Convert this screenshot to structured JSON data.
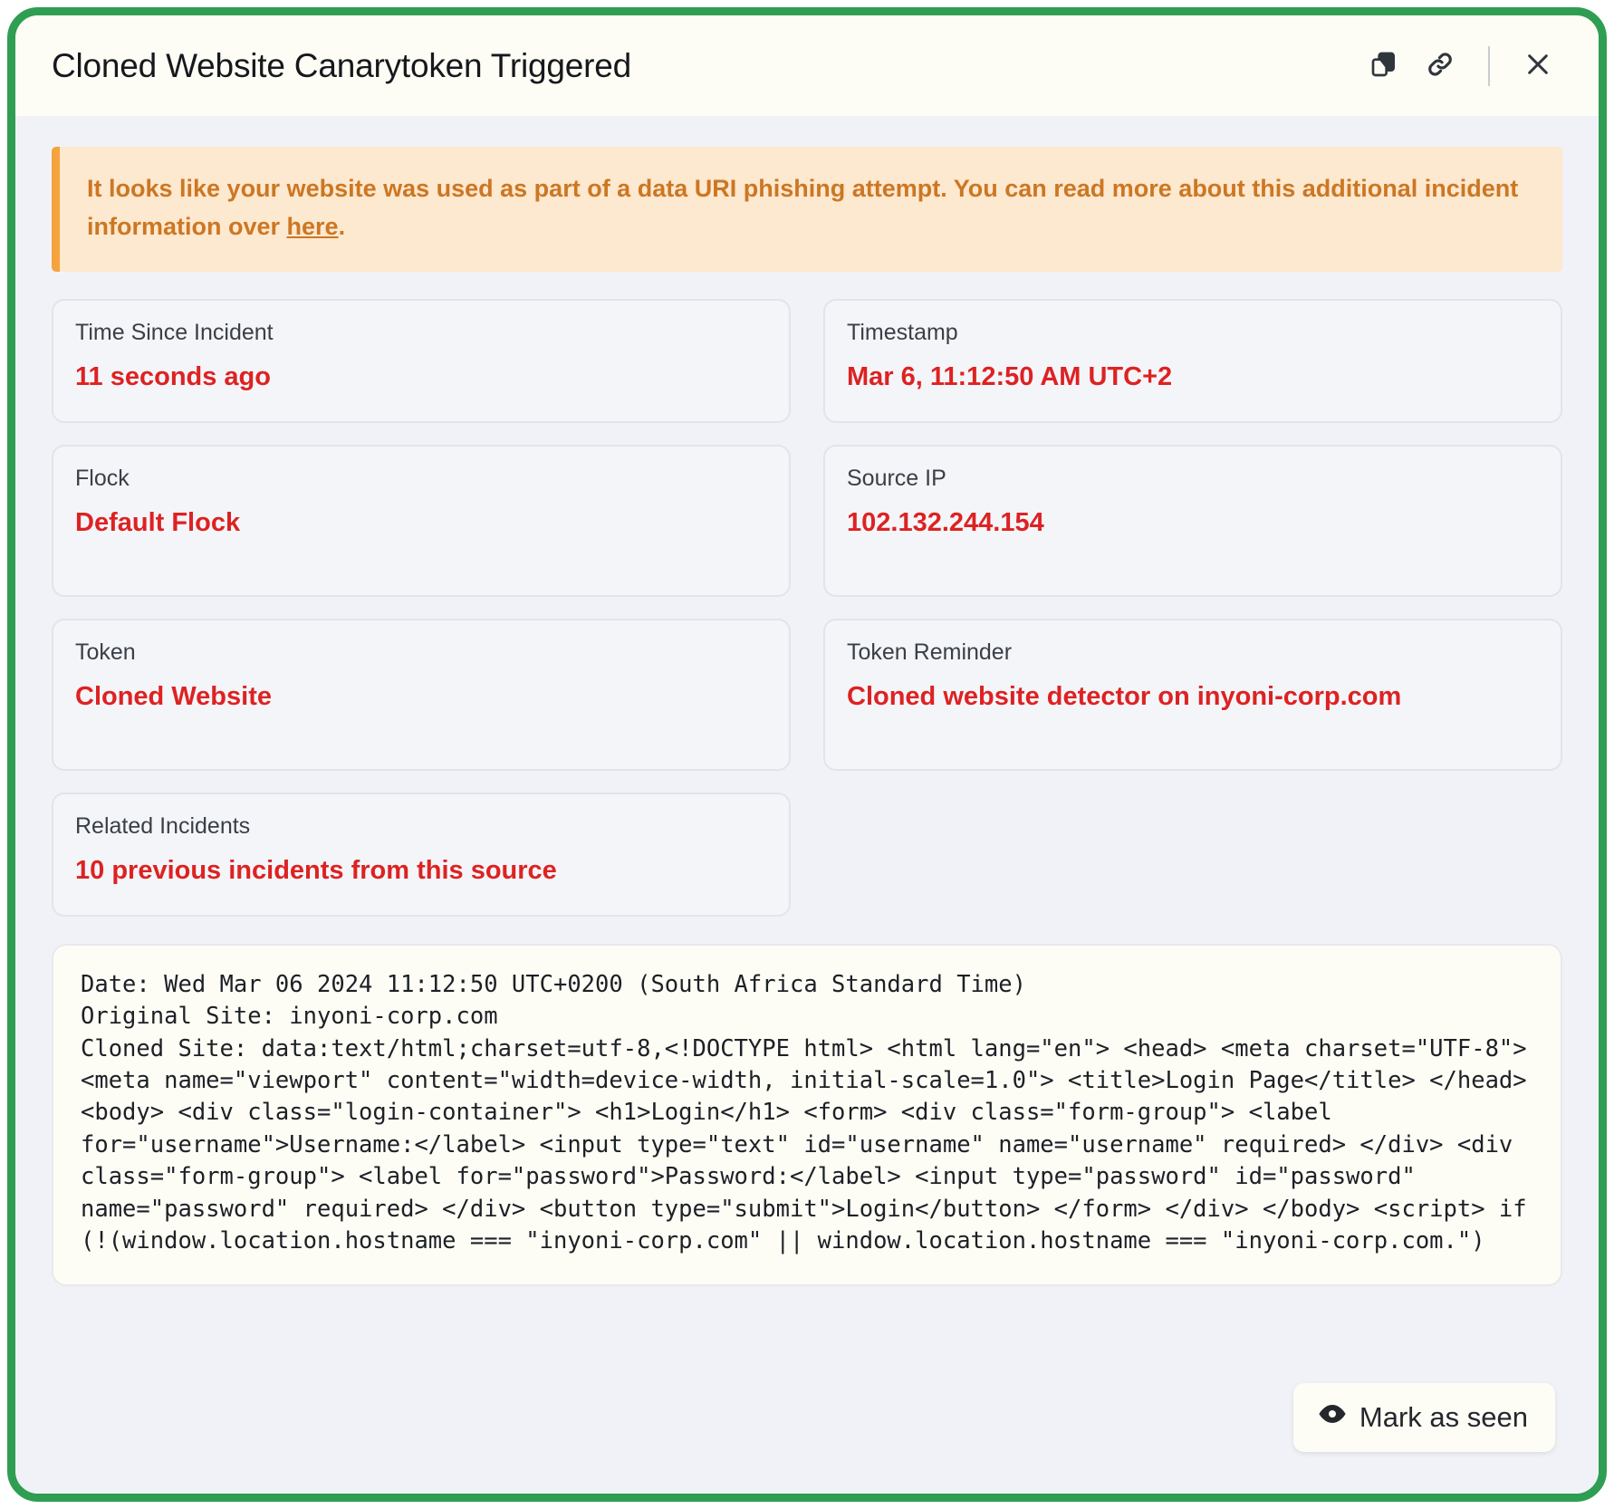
{
  "header": {
    "title": "Cloned Website Canarytoken Triggered",
    "actions": [
      {
        "name": "copy-icon",
        "label": "Copy"
      },
      {
        "name": "link-icon",
        "label": "Copy link"
      },
      {
        "name": "close-icon",
        "label": "Close"
      }
    ]
  },
  "alert": {
    "text_before": "It looks like your website was used as part of a data URI phishing attempt. You can read more about this additional incident information over ",
    "link_text": "here",
    "text_after": "."
  },
  "info_cards": [
    {
      "label": "Time Since Incident",
      "value": "11 seconds ago"
    },
    {
      "label": "Timestamp",
      "value": "Mar 6, 11:12:50 AM UTC+2"
    },
    {
      "label": "Flock",
      "value": "Default Flock"
    },
    {
      "label": "Source IP",
      "value": "102.132.244.154"
    },
    {
      "label": "Token",
      "value": "Cloned Website"
    },
    {
      "label": "Token Reminder",
      "value": "Cloned website detector on inyoni-corp.com"
    },
    {
      "label": "Related Incidents",
      "value": "10 previous incidents from this source"
    }
  ],
  "code_block": {
    "content": "Date: Wed Mar 06 2024 11:12:50 UTC+0200 (South Africa Standard Time)\nOriginal Site: inyoni-corp.com\nCloned Site: data:text/html;charset=utf-8,<!DOCTYPE html> <html lang=\"en\"> <head> <meta charset=\"UTF-8\"> <meta name=\"viewport\" content=\"width=device-width, initial-scale=1.0\"> <title>Login Page</title> </head> <body> <div class=\"login-container\"> <h1>Login</h1> <form> <div class=\"form-group\"> <label for=\"username\">Username:</label> <input type=\"text\" id=\"username\" name=\"username\" required> </div> <div class=\"form-group\"> <label for=\"password\">Password:</label> <input type=\"password\" id=\"password\" name=\"password\" required> </div> <button type=\"submit\">Login</button> </form> </div> </body> <script> if (!(window.location.hostname === \"inyoni-corp.com\" || window.location.hostname === \"inyoni-corp.com.\")"
  },
  "footer": {
    "mark_as_seen_label": "Mark as seen"
  },
  "colors": {
    "frame_border": "#2f9e52",
    "alert_background": "#fde8d0",
    "alert_accent": "#f5a33c",
    "alert_text": "#cc7722",
    "value_red": "#dd2222",
    "body_background": "#f1f2f7",
    "card_background": "#f4f5f9",
    "panel_background": "#fdfdf6"
  }
}
